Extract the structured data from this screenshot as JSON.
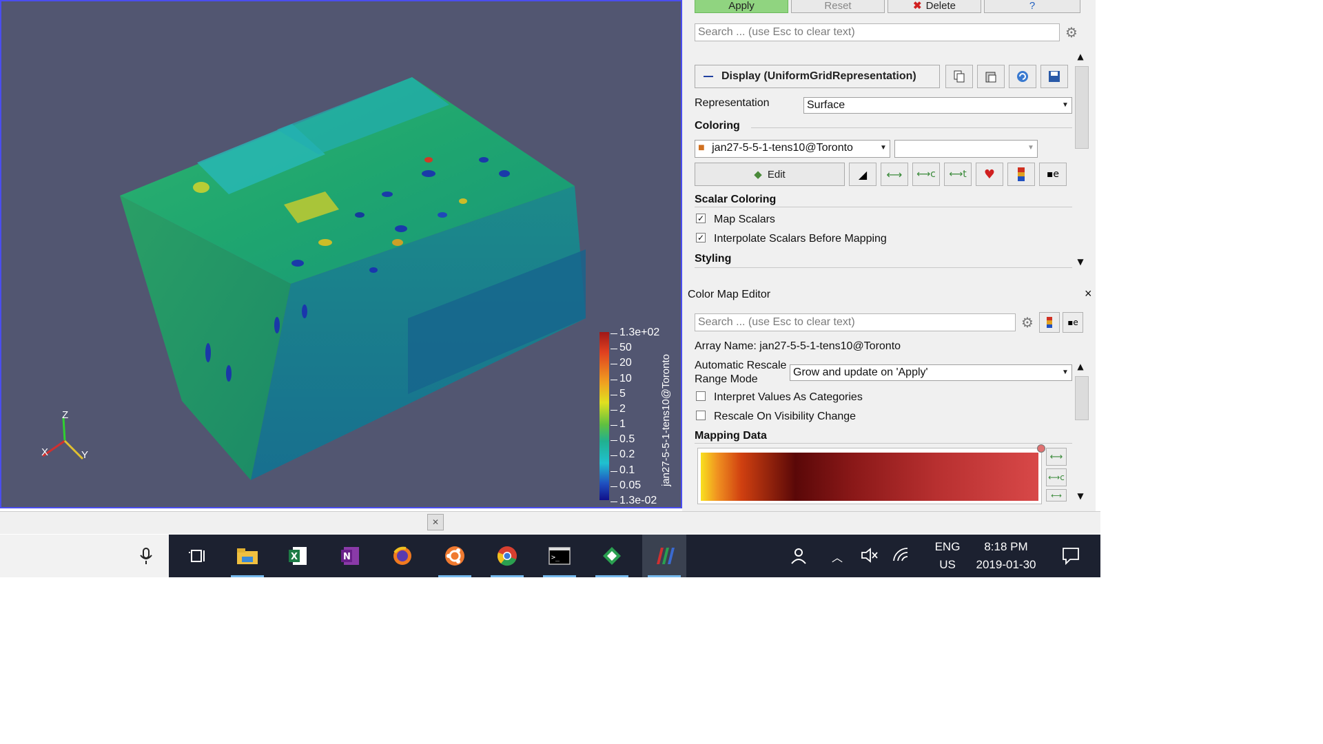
{
  "toolbar": {
    "apply": "Apply",
    "reset": "Reset",
    "delete": "Delete",
    "help": "?"
  },
  "properties": {
    "search_placeholder": "Search ... (use Esc to clear text)",
    "display_title": "Display (UniformGridRepresentation)",
    "representation_label": "Representation",
    "representation_value": "Surface",
    "coloring_header": "Coloring",
    "coloring_array": "jan27-5-5-1-tens10@Toronto",
    "edit_label": "Edit",
    "scalar_coloring_header": "Scalar Coloring",
    "map_scalars": "Map Scalars",
    "map_scalars_checked": true,
    "interpolate_scalars": "Interpolate Scalars Before Mapping",
    "interpolate_checked": true,
    "styling_header": "Styling"
  },
  "colormap_editor": {
    "title": "Color Map Editor",
    "close": "×",
    "search_placeholder": "Search ... (use Esc to clear text)",
    "array_name": "Array Name: jan27-5-5-1-tens10@Toronto",
    "rescale_label_1": "Automatic Rescale",
    "rescale_label_2": "Range Mode",
    "rescale_value": "Grow and update on 'Apply'",
    "interpret_categories": "Interpret Values As Categories",
    "rescale_visibility": "Rescale On Visibility Change",
    "mapping_data_header": "Mapping Data"
  },
  "legend": {
    "title": "jan27-5-5-1-tens10@Toronto",
    "ticks": [
      "1.3e+02",
      "50",
      "20",
      "10",
      "5",
      "2",
      "1",
      "0.5",
      "0.2",
      "0.1",
      "0.05",
      "1.3e-02"
    ]
  },
  "axes": {
    "z": "Z",
    "x": "X",
    "y": "Y"
  },
  "tray": {
    "lang_top": "ENG",
    "lang_bottom": "US",
    "time": "8:18 PM",
    "date": "2019-01-30"
  },
  "colors": {
    "viewport_bg": "#525671",
    "apply_green": "#90d480",
    "taskbar": "#1c2130"
  }
}
